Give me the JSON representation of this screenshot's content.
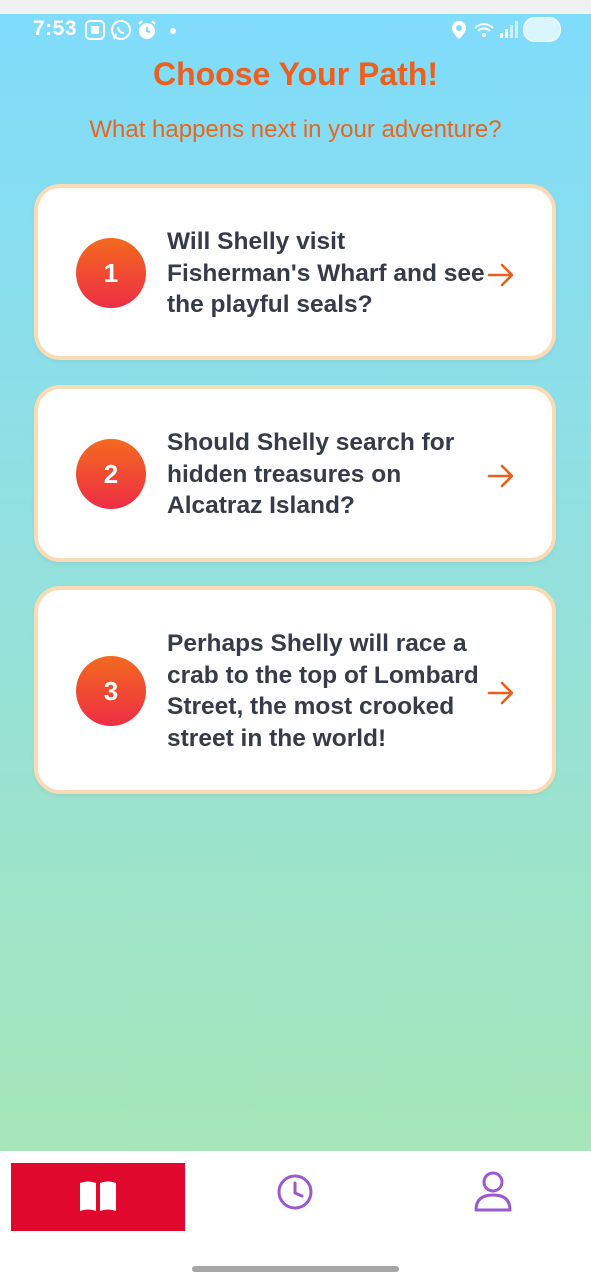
{
  "status_bar": {
    "time": "7:53",
    "icons": [
      "screenshot-icon",
      "whatsapp-icon",
      "alarm-icon",
      "location-icon",
      "wifi-icon",
      "signal-icon",
      "battery-toggle"
    ]
  },
  "header": {
    "title": "Choose Your Path!",
    "subtitle": "What happens next in your adventure?"
  },
  "choices": [
    {
      "number": "1",
      "text": "Will Shelly visit Fisherman's Wharf and see the playful seals?",
      "icon": "arrow-right-icon"
    },
    {
      "number": "2",
      "text": "Should Shelly search for hidden treasures on Alcatraz Island?",
      "icon": "arrow-right-icon"
    },
    {
      "number": "3",
      "text": "Perhaps Shelly will race a crab to the top of Lombard Street, the most crooked street in the world!",
      "icon": "arrow-right-icon"
    }
  ],
  "bottom_nav": {
    "items": [
      {
        "icon": "book-icon",
        "active": true
      },
      {
        "icon": "clock-icon",
        "active": false
      },
      {
        "icon": "user-icon",
        "active": false
      }
    ]
  },
  "colors": {
    "accent": "#ec5f1c",
    "nav_active": "#e0082d",
    "nav_icon": "#9b59d0",
    "card_border": "#fbdbb6",
    "card_text": "#353b48"
  }
}
